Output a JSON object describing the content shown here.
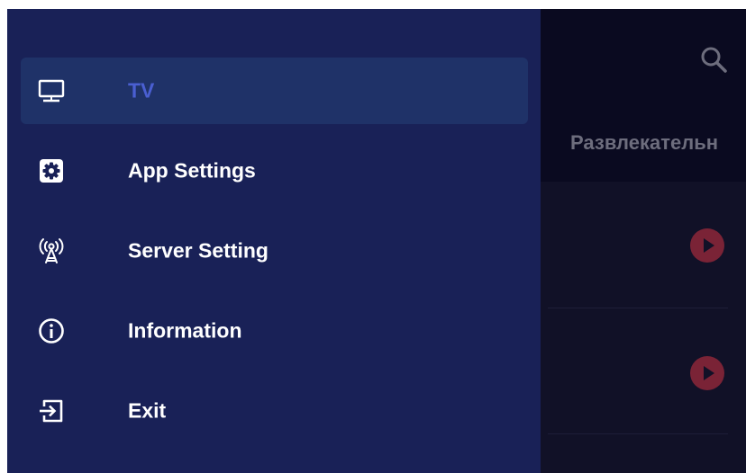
{
  "background_app": {
    "category_tab": "Развлекательн",
    "search_icon": "search-icon",
    "play_icon": "play-icon",
    "play_color": "#7a2336"
  },
  "drawer": {
    "background": "#192157",
    "active_color": "#4a5fd1",
    "items": [
      {
        "label": "TV",
        "icon": "tv-icon",
        "active": true
      },
      {
        "label": "App Settings",
        "icon": "gear-icon",
        "active": false
      },
      {
        "label": "Server Setting",
        "icon": "antenna-icon",
        "active": false
      },
      {
        "label": "Information",
        "icon": "info-icon",
        "active": false
      },
      {
        "label": "Exit",
        "icon": "exit-icon",
        "active": false
      }
    ]
  }
}
